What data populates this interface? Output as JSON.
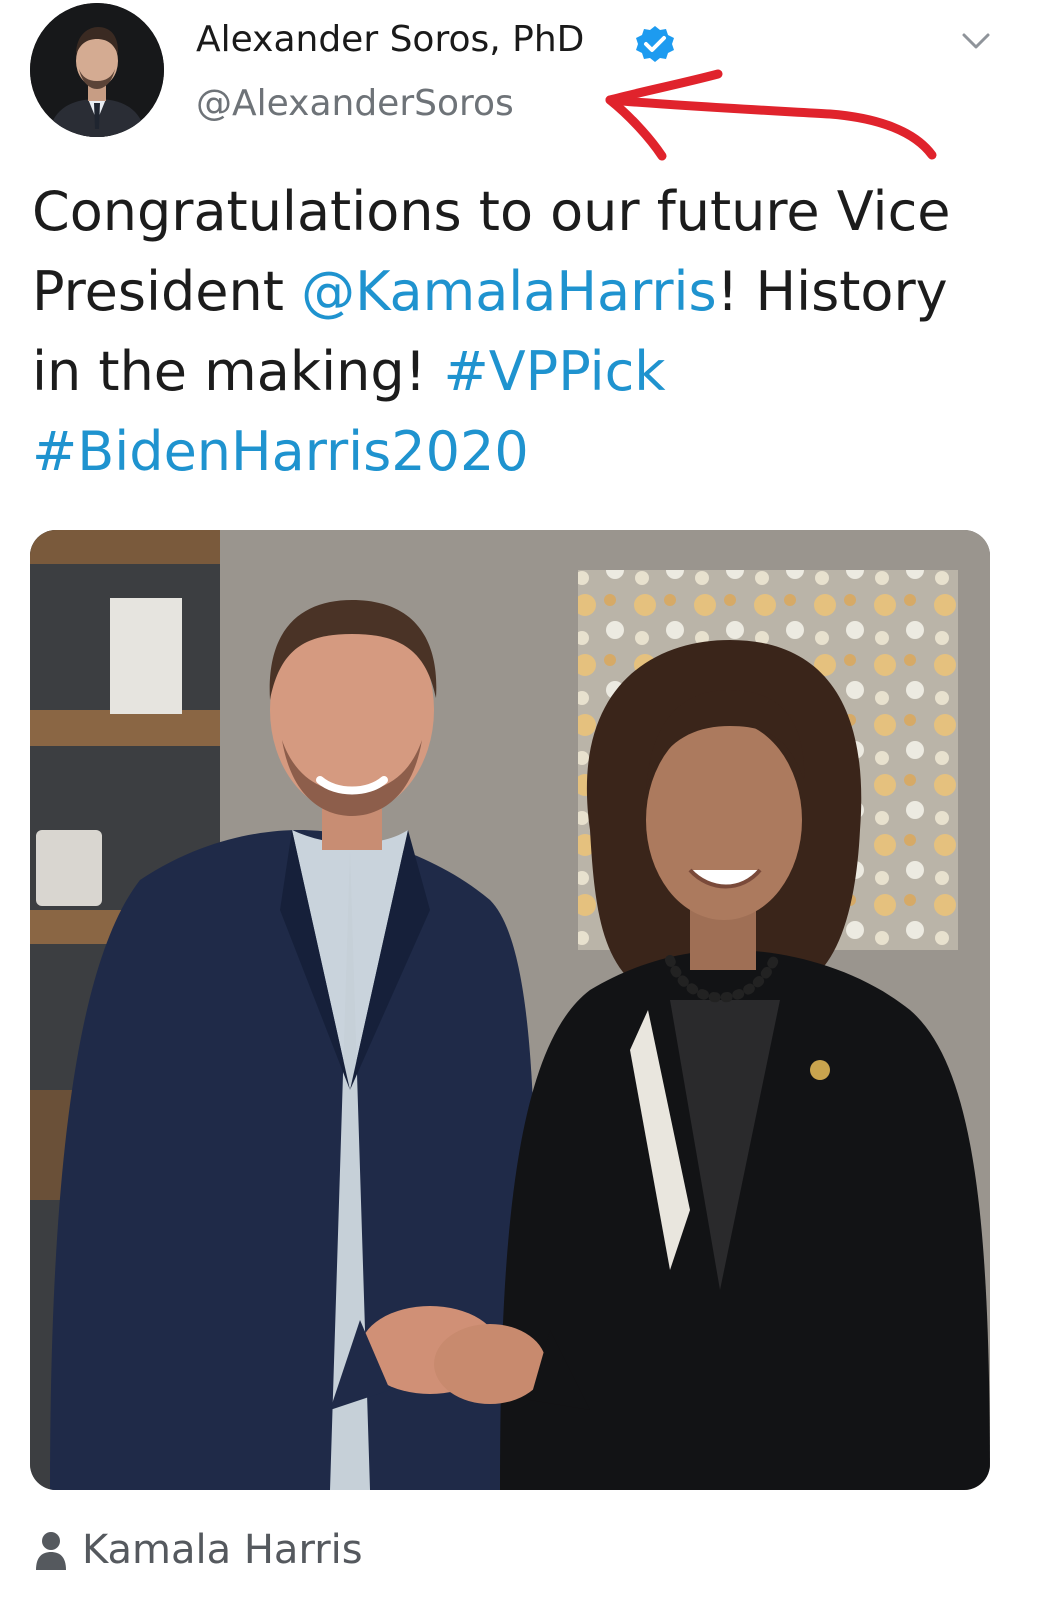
{
  "author": {
    "display_name": "Alexander Soros, PhD",
    "handle": "@AlexanderSoros",
    "verified": true,
    "avatar_icon": "profile-photo",
    "verified_icon": "verified-badge-icon"
  },
  "menu": {
    "icon": "chevron-down-icon"
  },
  "tweet": {
    "text_1": "Congratulations to our future Vice President ",
    "mention": "@KamalaHarris",
    "text_2": "! History in the making! ",
    "hashtag_1": "#VPPick",
    "text_3": " ",
    "hashtag_2": "#BidenHarris2020"
  },
  "media": {
    "description_icon": "photo"
  },
  "tagged": {
    "icon": "person-icon",
    "name": "Kamala Harris"
  },
  "colors": {
    "link": "#1f93cf",
    "verified": "#1d9bf0",
    "annotation": "#e0232c",
    "secondary_text": "#6e7378"
  }
}
